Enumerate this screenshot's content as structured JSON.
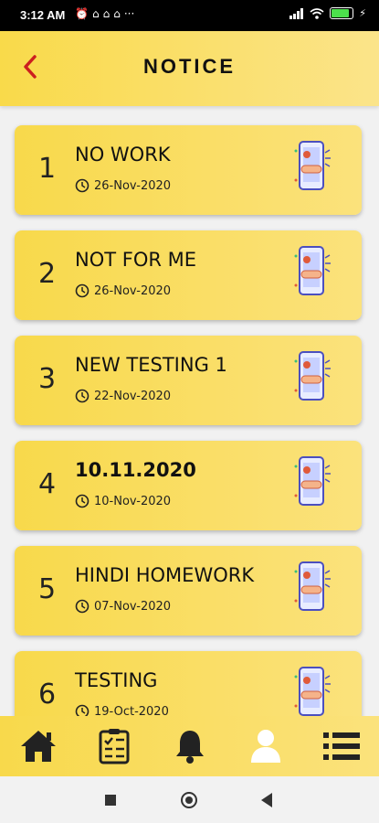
{
  "status_bar": {
    "time": "3:12 AM",
    "left_icons": [
      "alarm-icon",
      "notification-icon",
      "notification-icon",
      "notification-icon",
      "more-icon"
    ],
    "right_icons": [
      "signal-icon",
      "wifi-icon",
      "battery-icon",
      "charging-icon"
    ],
    "battery_level": 0.9,
    "battery_label": "90"
  },
  "header": {
    "title": "NOTICE",
    "back_icon": "chevron-left-icon"
  },
  "notices": [
    {
      "index": "1",
      "title": "NO WORK",
      "date": "26-Nov-2020"
    },
    {
      "index": "2",
      "title": "NOT FOR ME",
      "date": "26-Nov-2020"
    },
    {
      "index": "3",
      "title": "NEW TESTING 1",
      "date": "22-Nov-2020"
    },
    {
      "index": "4",
      "title": "10.11.2020",
      "date": "10-Nov-2020"
    },
    {
      "index": "5",
      "title": "HINDI HOMEWORK",
      "date": "07-Nov-2020"
    },
    {
      "index": "6",
      "title": "TESTING",
      "date": "19-Oct-2020"
    }
  ],
  "bottom_nav": [
    {
      "name": "home",
      "icon": "home-icon"
    },
    {
      "name": "homework",
      "icon": "checklist-icon"
    },
    {
      "name": "notifications",
      "icon": "bell-icon"
    },
    {
      "name": "profile",
      "icon": "user-icon",
      "active": true
    },
    {
      "name": "menu",
      "icon": "list-icon"
    }
  ],
  "colors": {
    "accent": "#f9da4a",
    "back_arrow": "#cc1f1f",
    "text": "#111111"
  }
}
